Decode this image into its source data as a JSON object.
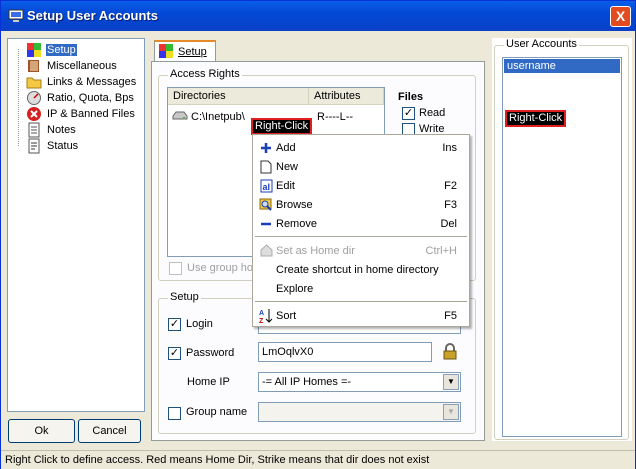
{
  "window": {
    "title": "Setup User Accounts",
    "close_glyph": "X"
  },
  "tree": {
    "items": [
      {
        "label": "Setup",
        "icon": "setup-blocks-icon",
        "selected": true
      },
      {
        "label": "Miscellaneous",
        "icon": "book-icon"
      },
      {
        "label": "Links & Messages",
        "icon": "folder-icon"
      },
      {
        "label": "Ratio, Quota, Bps",
        "icon": "gauge-icon"
      },
      {
        "label": "IP & Banned Files",
        "icon": "banned-icon"
      },
      {
        "label": "Notes",
        "icon": "notes-icon"
      },
      {
        "label": "Status",
        "icon": "status-icon"
      }
    ]
  },
  "buttons": {
    "ok": "Ok",
    "cancel": "Cancel"
  },
  "tab": {
    "label": "Setup"
  },
  "access_rights": {
    "title": "Access Rights",
    "columns": [
      "Directories",
      "Attributes"
    ],
    "rows": [
      {
        "directory": "C:\\Inetpub\\",
        "attributes": "R----L--"
      }
    ],
    "files_title": "Files",
    "files": [
      {
        "label": "Read",
        "checked": true
      },
      {
        "label": "Write",
        "checked": false
      }
    ],
    "use_group_label": "Use group ho"
  },
  "setup": {
    "title": "Setup",
    "login_label": "Login",
    "login_checked": true,
    "password_label": "Password",
    "password_checked": true,
    "password_value": "LmOqlvX0",
    "home_ip_label": "Home IP",
    "home_ip_value": "-= All IP Homes =-",
    "group_name_label": "Group name",
    "group_checked": false,
    "group_value": ""
  },
  "user_accounts": {
    "title": "User Accounts",
    "users": [
      "username"
    ]
  },
  "callouts": {
    "left": "Right-Click",
    "right": "Right-Click"
  },
  "context_menu": {
    "items": [
      {
        "label": "Add",
        "shortcut": "Ins",
        "icon": "plus-icon"
      },
      {
        "label": "New",
        "shortcut": "",
        "icon": "new-doc-icon"
      },
      {
        "label": "Edit",
        "shortcut": "F2",
        "icon": "edit-icon"
      },
      {
        "label": "Browse",
        "shortcut": "F3",
        "icon": "browse-icon"
      },
      {
        "label": "Remove",
        "shortcut": "Del",
        "icon": "minus-icon"
      },
      {
        "label": "Set as Home dir",
        "shortcut": "Ctrl+H",
        "icon": "home-icon",
        "disabled": true
      },
      {
        "label": "Create shortcut in home directory",
        "shortcut": ""
      },
      {
        "label": "Explore",
        "shortcut": ""
      },
      {
        "label": "Sort",
        "shortcut": "F5",
        "icon": "sort-az-icon"
      }
    ]
  },
  "status": {
    "text": "Right Click to define access. Red means Home Dir, Strike means that dir does not exist"
  },
  "colors": {
    "title_blue": "#0a5ee8",
    "selection": "#316ac5",
    "callout_border": "#e02020"
  }
}
